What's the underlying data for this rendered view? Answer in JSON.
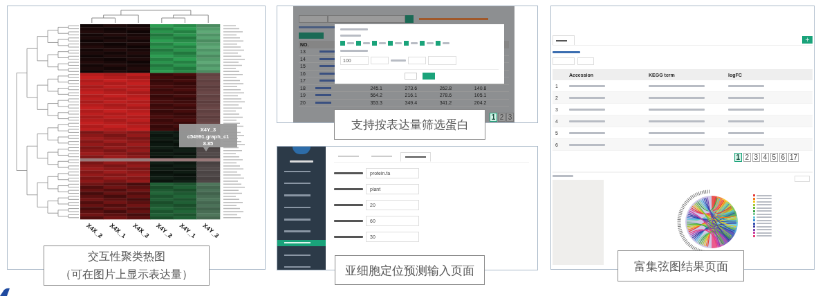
{
  "heatmap_panel": {
    "columns": [
      "X4X_2",
      "X4X_1",
      "X4X_3",
      "X4Y_2",
      "X4Y_1",
      "X4Y_3"
    ],
    "tooltip": {
      "sample": "X4Y_3",
      "gene": "c54991.graph_c1",
      "value": "8.85"
    },
    "caption": [
      "交互性聚类热图",
      "（可在图片上显示表达量）"
    ]
  },
  "filter_panel": {
    "table": {
      "header": "NO.",
      "rows": [
        {
          "no": "13",
          "values": []
        },
        {
          "no": "14",
          "values": []
        },
        {
          "no": "15",
          "values": []
        },
        {
          "no": "16",
          "values": []
        },
        {
          "no": "17",
          "values": []
        },
        {
          "no": "18",
          "values": [
            "245.1",
            "273.6",
            "262.8",
            "140.8"
          ]
        },
        {
          "no": "19",
          "values": [
            "564.2",
            "216.1",
            "278.6",
            "105.1"
          ]
        },
        {
          "no": "20",
          "values": [
            "353.3",
            "349.4",
            "341.2",
            "204.2"
          ]
        }
      ]
    },
    "dialog": {
      "checkboxes": [
        {
          "checked": true
        },
        {
          "checked": true
        },
        {
          "checked": true
        },
        {
          "checked": true
        },
        {
          "checked": true
        },
        {
          "checked": true
        },
        {
          "checked": true
        }
      ],
      "threshold": "100"
    },
    "pages": [
      {
        "label": "1",
        "selected": true
      },
      {
        "label": "2",
        "selected": false
      },
      {
        "label": "3",
        "selected": false
      }
    ],
    "caption": "支持按表达量筛选蛋白"
  },
  "localization_panel": {
    "sidebar": [
      {
        "selected": false
      },
      {
        "selected": false
      },
      {
        "selected": false
      },
      {
        "selected": false
      },
      {
        "selected": false
      },
      {
        "selected": false
      },
      {
        "selected": true
      },
      {
        "selected": false
      },
      {
        "selected": false
      }
    ],
    "tabs": [
      {
        "selected": false
      },
      {
        "selected": false
      },
      {
        "selected": true
      }
    ],
    "fields": [
      "protein.fa",
      "plant",
      "20",
      "60",
      "30"
    ],
    "caption": "亚细胞定位预测输入页面"
  },
  "chord_panel": {
    "add_button": "+",
    "columns": [
      "Accession",
      "KEGG term",
      "logFC"
    ],
    "rows": [
      "1",
      "2",
      "3",
      "4",
      "5",
      "6"
    ],
    "pages": [
      {
        "label": "1",
        "selected": true
      },
      {
        "label": "2",
        "selected": false
      },
      {
        "label": "3",
        "selected": false
      },
      {
        "label": "4",
        "selected": false
      },
      {
        "label": "5",
        "selected": false
      },
      {
        "label": "6",
        "selected": false
      },
      {
        "label": "17",
        "selected": false
      }
    ],
    "legend": [
      {
        "color": "#e53935"
      },
      {
        "color": "#f4791f"
      },
      {
        "color": "#f5c518"
      },
      {
        "color": "#a6c93a"
      },
      {
        "color": "#6bbf3a"
      },
      {
        "color": "#3aa34a"
      },
      {
        "color": "#7fcf9a"
      },
      {
        "color": "#5fc5d8"
      },
      {
        "color": "#3b8fd6"
      },
      {
        "color": "#2f4fb0"
      },
      {
        "color": "#3a3aa0"
      },
      {
        "color": "#7a4ab0"
      },
      {
        "color": "#c83aa0"
      },
      {
        "color": "#e8407a"
      }
    ],
    "caption": "富集弦图结果页面"
  }
}
